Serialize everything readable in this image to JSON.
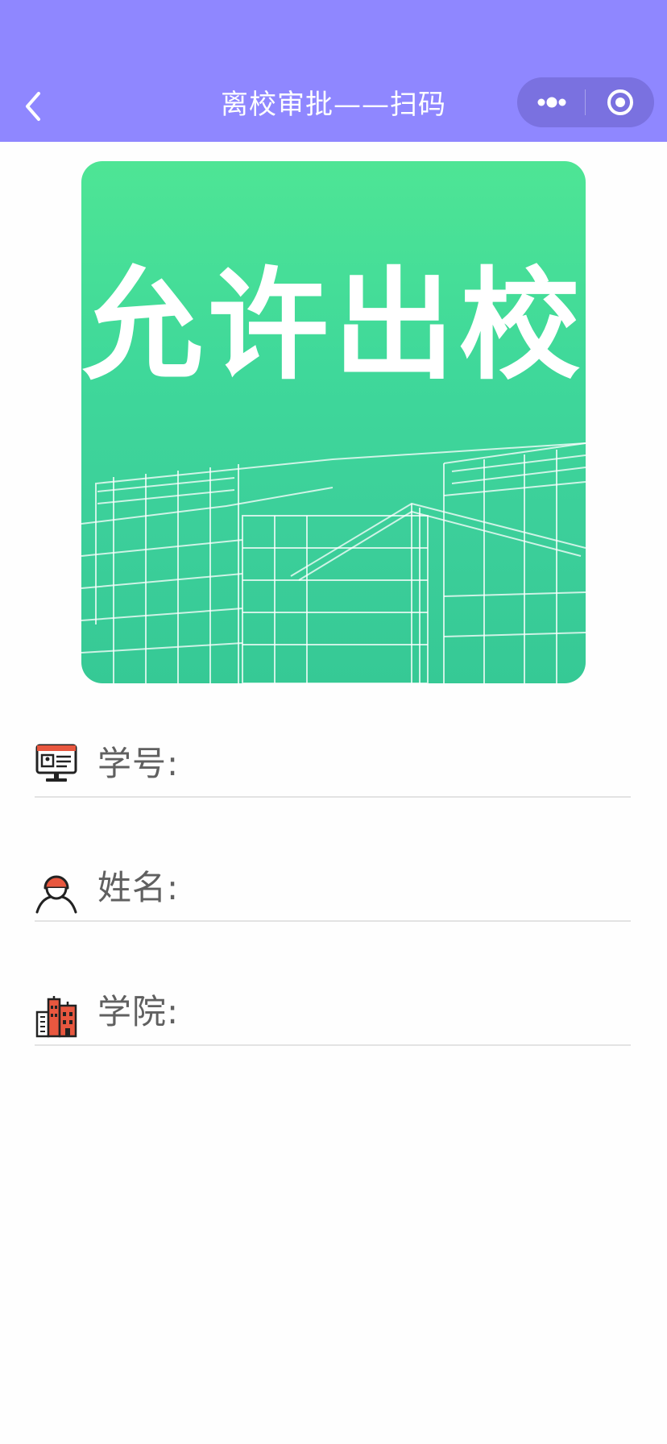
{
  "nav": {
    "title": "离校审批——扫码",
    "background": "#8f87ff"
  },
  "pass": {
    "text": "允许出校",
    "colors": {
      "top": "#4ee595",
      "bottom": "#36c995"
    }
  },
  "form": {
    "student_id_label": "学号:",
    "name_label": "姓名:",
    "college_label": "学院:"
  },
  "icons": {
    "back": "chevron-left-icon",
    "more": "more-dots-icon",
    "close": "target-close-icon",
    "student_id": "id-card-monitor-icon",
    "name": "person-icon",
    "college": "buildings-icon"
  },
  "colors": {
    "accent": "#8f87ff",
    "label_text": "#606060",
    "divider": "#e3e3e3",
    "icon_red": "#e8573f"
  }
}
